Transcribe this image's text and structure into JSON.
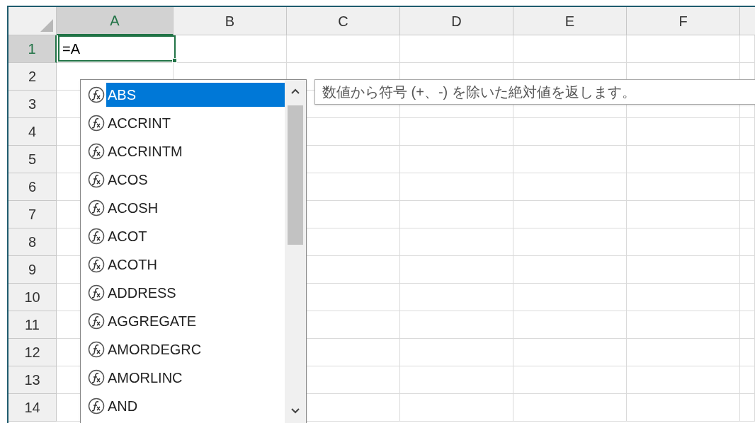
{
  "columns": [
    {
      "label": "A",
      "selected": true
    },
    {
      "label": "B",
      "selected": false
    },
    {
      "label": "C",
      "selected": false
    },
    {
      "label": "D",
      "selected": false
    },
    {
      "label": "E",
      "selected": false
    },
    {
      "label": "F",
      "selected": false
    }
  ],
  "rows": [
    {
      "label": "1",
      "selected": true
    },
    {
      "label": "2",
      "selected": false
    },
    {
      "label": "3",
      "selected": false
    },
    {
      "label": "4",
      "selected": false
    },
    {
      "label": "5",
      "selected": false
    },
    {
      "label": "6",
      "selected": false
    },
    {
      "label": "7",
      "selected": false
    },
    {
      "label": "8",
      "selected": false
    },
    {
      "label": "9",
      "selected": false
    },
    {
      "label": "10",
      "selected": false
    },
    {
      "label": "11",
      "selected": false
    },
    {
      "label": "12",
      "selected": false
    },
    {
      "label": "13",
      "selected": false
    },
    {
      "label": "14",
      "selected": false
    }
  ],
  "active_cell": {
    "value": "=A"
  },
  "autocomplete": {
    "items": [
      {
        "label": "ABS",
        "selected": true
      },
      {
        "label": "ACCRINT",
        "selected": false
      },
      {
        "label": "ACCRINTM",
        "selected": false
      },
      {
        "label": "ACOS",
        "selected": false
      },
      {
        "label": "ACOSH",
        "selected": false
      },
      {
        "label": "ACOT",
        "selected": false
      },
      {
        "label": "ACOTH",
        "selected": false
      },
      {
        "label": "ADDRESS",
        "selected": false
      },
      {
        "label": "AGGREGATE",
        "selected": false
      },
      {
        "label": "AMORDEGRC",
        "selected": false
      },
      {
        "label": "AMORLINC",
        "selected": false
      },
      {
        "label": "AND",
        "selected": false
      }
    ]
  },
  "tooltip": {
    "text": "数値から符号 (+、-) を除いた絶対値を返します。"
  }
}
